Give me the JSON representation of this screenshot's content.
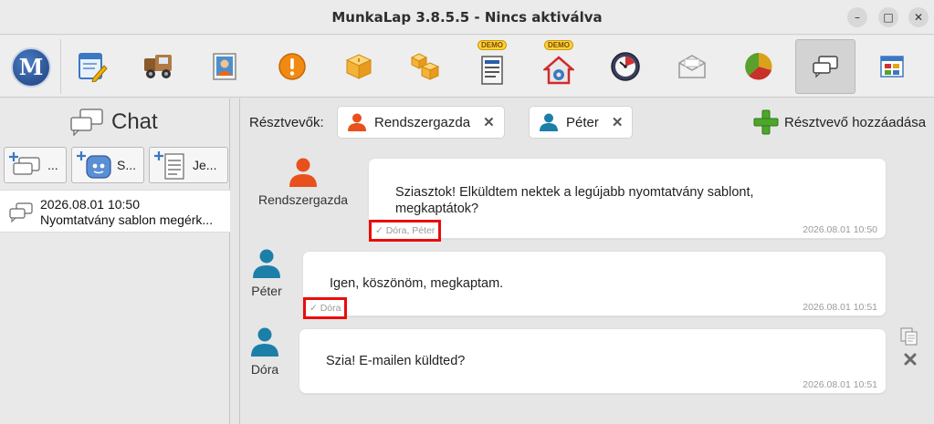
{
  "window": {
    "title": "MunkaLap 3.8.5.5 - Nincs aktiválva",
    "minimize_label": "–",
    "maximize_label": "□",
    "close_label": "✕"
  },
  "toolbar": {
    "logo_text": "M",
    "buttons": [
      {
        "name": "worksheet",
        "icon": "form-edit-icon"
      },
      {
        "name": "vehicles",
        "icon": "truck-icon"
      },
      {
        "name": "contacts",
        "icon": "contact-card-icon"
      },
      {
        "name": "alerts",
        "icon": "warning-icon"
      },
      {
        "name": "product",
        "icon": "box-icon"
      },
      {
        "name": "inventory",
        "icon": "boxes-icon"
      },
      {
        "name": "documents",
        "icon": "document-list-icon",
        "badge": "DEMO"
      },
      {
        "name": "service",
        "icon": "house-gear-icon",
        "badge": "DEMO"
      },
      {
        "name": "time",
        "icon": "clock-icon"
      },
      {
        "name": "mail",
        "icon": "envelope-icon"
      },
      {
        "name": "statistics",
        "icon": "pie-chart-icon"
      },
      {
        "name": "chat",
        "icon": "chat-bubbles-icon",
        "active": true
      },
      {
        "name": "dashboard",
        "icon": "window-grid-icon"
      }
    ]
  },
  "sidebar": {
    "heading": "Chat",
    "buttons": [
      {
        "label": "..."
      },
      {
        "label": "S..."
      },
      {
        "label": "Je..."
      }
    ],
    "conversations": [
      {
        "date": "2026.08.01 10:50",
        "preview": "Nyomtatvány sablon megérk..."
      }
    ]
  },
  "chat": {
    "participants_label": "Résztvevők:",
    "participants": [
      {
        "name": "Rendszergazda",
        "color": "#e8501c",
        "remove": "✕"
      },
      {
        "name": "Péter",
        "color": "#1c7fa8",
        "remove": "✕"
      }
    ],
    "add_participant": "Résztvevő hozzáadása",
    "messages": [
      {
        "sender": "Rendszergazda",
        "color": "#e8501c",
        "text_line1": "Sziasztok! Elküldtem nektek a legújabb nyomtatvány sablont,",
        "text_line2": "megkaptátok?",
        "seen_by": "✓ Dóra, Péter",
        "time": "2026.08.01 10:50"
      },
      {
        "sender": "Péter",
        "color": "#1c7fa8",
        "text_line1": "Igen, köszönöm, megkaptam.",
        "seen_by": "✓ Dóra",
        "time": "2026.08.01 10:51"
      },
      {
        "sender": "Dóra",
        "color": "#1c7fa8",
        "text_line1": "Szia! E-mailen küldted?",
        "time": "2026.08.01 10:51"
      }
    ]
  }
}
